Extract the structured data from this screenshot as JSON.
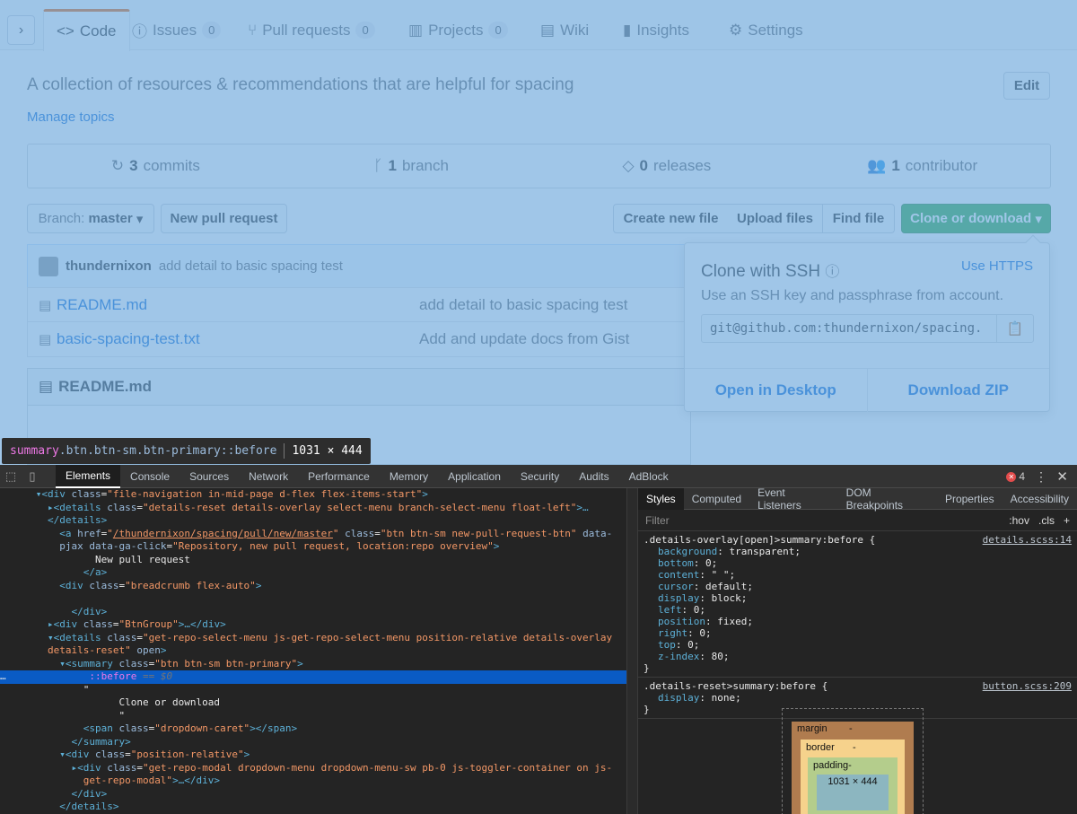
{
  "tabs": [
    {
      "label": "Code",
      "icon": "code-icon",
      "count": null
    },
    {
      "label": "Issues",
      "icon": "issue-icon",
      "count": "0"
    },
    {
      "label": "Pull requests",
      "icon": "pull-request-icon",
      "count": "0"
    },
    {
      "label": "Projects",
      "icon": "project-icon",
      "count": "0"
    },
    {
      "label": "Wiki",
      "icon": "book-icon",
      "count": null
    },
    {
      "label": "Insights",
      "icon": "graph-icon",
      "count": null
    },
    {
      "label": "Settings",
      "icon": "gear-icon",
      "count": null
    }
  ],
  "repo": {
    "description": "A collection of resources & recommendations that are helpful for spacing",
    "edit_label": "Edit",
    "manage_topics": "Manage topics"
  },
  "summary": {
    "commits_n": "3",
    "commits_label": "commits",
    "branch_n": "1",
    "branch_label": "branch",
    "releases_n": "0",
    "releases_label": "releases",
    "contributor_n": "1",
    "contributor_label": "contributor"
  },
  "toolbar": {
    "branch_prefix": "Branch:",
    "branch_name": "master",
    "new_pr": "New pull request",
    "create_file": "Create new file",
    "upload_files": "Upload files",
    "find_file": "Find file",
    "clone": "Clone or download"
  },
  "commit": {
    "author": "thundernixon",
    "message": "add detail to basic spacing test"
  },
  "files": [
    {
      "name": "README.md",
      "message": "add detail to basic spacing test"
    },
    {
      "name": "basic-spacing-test.txt",
      "message": "Add and update docs from Gist"
    }
  ],
  "readme_header": "README.md",
  "clone_popup": {
    "title": "Clone with SSH",
    "use_https": "Use HTTPS",
    "subtitle": "Use an SSH key and passphrase from account.",
    "url": "git@github.com:thundernixon/spacing.",
    "open_desktop": "Open in Desktop",
    "download_zip": "Download ZIP"
  },
  "tooltip": {
    "tag": "summary",
    "classes": ".btn.btn-sm.btn-primary::before",
    "size": "1031 × 444"
  },
  "devtools": {
    "tabs": [
      "Elements",
      "Console",
      "Sources",
      "Network",
      "Performance",
      "Memory",
      "Application",
      "Security",
      "Audits",
      "AdBlock"
    ],
    "error_count": "4",
    "styles_tabs": [
      "Styles",
      "Computed",
      "Event Listeners",
      "DOM Breakpoints",
      "Properties",
      "Accessibility"
    ],
    "filter_placeholder": "Filter",
    "hov": ":hov",
    "cls": ".cls",
    "rule1_selector": ".details-overlay[open]>summary:before {",
    "rule1_source": "details.scss:14",
    "rule1_props": [
      [
        "background",
        "transparent;"
      ],
      [
        "bottom",
        "0;"
      ],
      [
        "content",
        "\" \";"
      ],
      [
        "cursor",
        "default;"
      ],
      [
        "display",
        "block;"
      ],
      [
        "left",
        "0;"
      ],
      [
        "position",
        "fixed;"
      ],
      [
        "right",
        "0;"
      ],
      [
        "top",
        "0;"
      ],
      [
        "z-index",
        "80;"
      ]
    ],
    "rule2_selector": ".details-reset>summary:before {",
    "rule2_source": "button.scss:209",
    "rule2_props": [
      [
        "display",
        "none;"
      ]
    ],
    "closing": "}",
    "box": {
      "margin": "margin",
      "border": "border",
      "padding": "padding-",
      "content": "1031 × 444",
      "dash": "-"
    }
  }
}
